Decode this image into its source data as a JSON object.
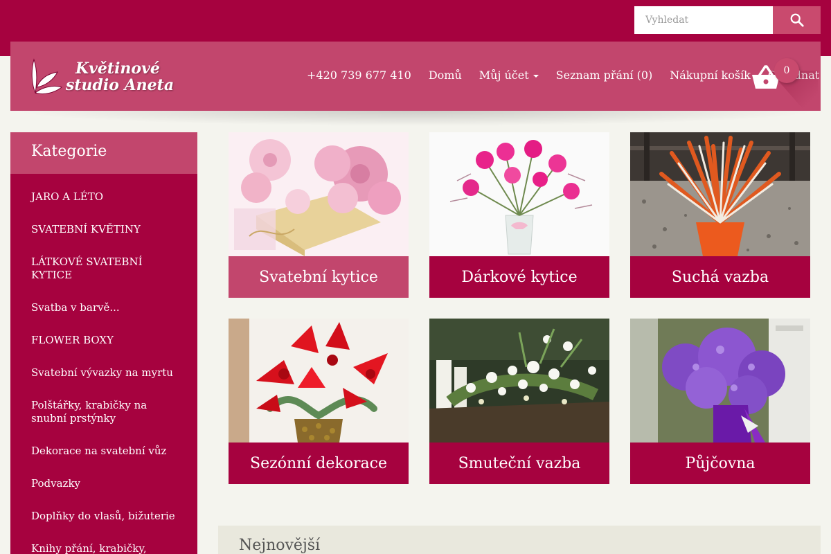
{
  "search": {
    "placeholder": "Vyhledat"
  },
  "logo": {
    "line1": "Květinové",
    "line2": "studio Aneta"
  },
  "nav": {
    "phone": "+420 739 677 410",
    "home": "Domů",
    "account": "Můj účet",
    "wishlist": "Seznam přání (0)",
    "cart": "Nákupní košík",
    "checkout": "Objednat"
  },
  "cart": {
    "count": "0"
  },
  "sidebar": {
    "title": "Kategorie",
    "items": [
      "JARO A LÉTO",
      "SVATEBNÍ KVĚTINY",
      "LÁTKOVÉ SVATEBNÍ KYTICE",
      "Svatba v barvě...",
      "FLOWER BOXY",
      "Svatební vývazky na myrtu",
      "Polštářky, krabičky na snubní prstýnky",
      "Dekorace na svatební vůz",
      "Podvazky",
      "Doplňky do vlasů, bižuterie",
      "Knihy přání, krabičky, jmenovky"
    ]
  },
  "tiles": [
    {
      "label": "Svatební kytice"
    },
    {
      "label": "Dárkové kytice"
    },
    {
      "label": "Suchá vazba"
    },
    {
      "label": "Sezónní dekorace"
    },
    {
      "label": "Smuteční vazba"
    },
    {
      "label": "Půjčovna"
    }
  ],
  "newest": {
    "title": "Nejnovější"
  },
  "colors": {
    "brand": "#a6023f",
    "accent": "#c2466d",
    "button": "#c94a6e"
  }
}
